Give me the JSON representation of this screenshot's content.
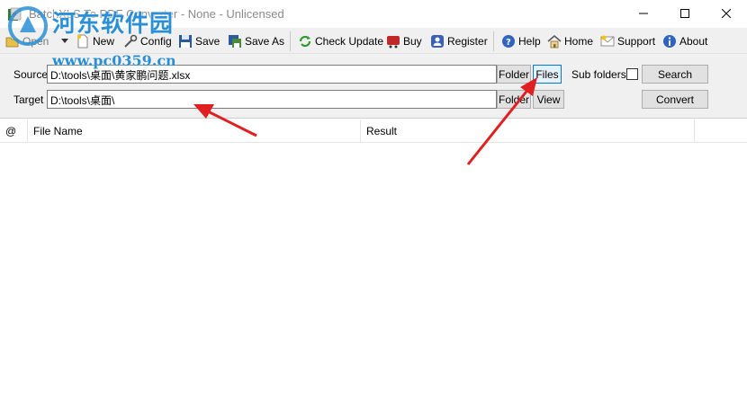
{
  "window": {
    "title": "BatchXLS To PDF Converter - None - Unlicensed"
  },
  "watermark": {
    "site_name": "河东软件园",
    "url": "www.pc0359.cn"
  },
  "toolbar": {
    "open": "Open",
    "new": "New",
    "config": "Config",
    "save": "Save",
    "save_as": "Save As",
    "check_update": "Check Update",
    "buy": "Buy",
    "register": "Register",
    "help": "Help",
    "home": "Home",
    "support": "Support",
    "about": "About"
  },
  "form": {
    "source_label": "Source",
    "source_value": "D:\\tools\\桌面\\黄家鹏问题.xlsx",
    "target_label": "Target",
    "target_value": "D:\\tools\\桌面\\",
    "folder_button": "Folder",
    "files_button": "Files",
    "target_folder_button": "Folder",
    "view_button": "View",
    "sub_folders_label": "Sub folders",
    "sub_folders_checked": false,
    "search_button": "Search",
    "convert_button": "Convert"
  },
  "list": {
    "columns": [
      "@",
      "File Name",
      "Result"
    ]
  },
  "colors": {
    "annotation_arrow": "#e02020",
    "watermark": "#2a8fd6",
    "active_border": "#0078d7"
  }
}
